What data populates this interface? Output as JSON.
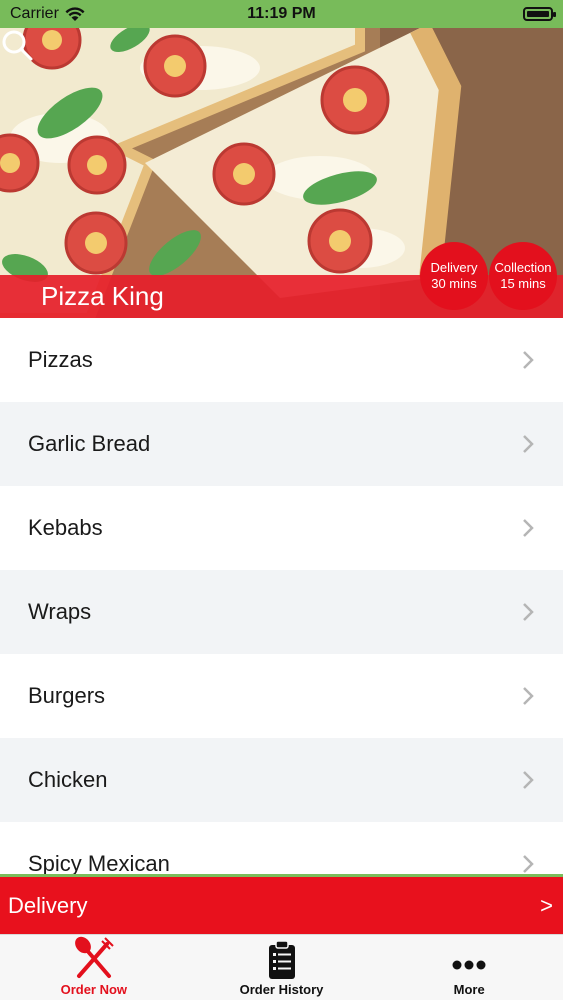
{
  "status_bar": {
    "carrier": "Carrier",
    "time": "11:19 PM"
  },
  "hero": {
    "restaurant_name": "Pizza King",
    "search_icon": "search-icon",
    "badges": {
      "delivery_label": "Delivery",
      "delivery_time": "30 mins",
      "collection_label": "Collection",
      "collection_time": "15 mins"
    }
  },
  "categories": [
    {
      "label": "Pizzas"
    },
    {
      "label": "Garlic Bread"
    },
    {
      "label": "Kebabs"
    },
    {
      "label": "Wraps"
    },
    {
      "label": "Burgers"
    },
    {
      "label": "Chicken"
    },
    {
      "label": "Spicy Mexican"
    }
  ],
  "delivery_bar": {
    "label": "Delivery",
    "arrow": ">"
  },
  "tab_bar": {
    "tabs": [
      {
        "label": "Order Now",
        "icon": "fork-knife-icon",
        "active": true
      },
      {
        "label": "Order History",
        "icon": "clipboard-list-icon",
        "active": false
      },
      {
        "label": "More",
        "icon": "more-dots-icon",
        "active": false
      }
    ]
  },
  "colors": {
    "brand_red": "#e3101d",
    "status_green": "#78bb5a",
    "row_alt": "#f2f4f6"
  }
}
